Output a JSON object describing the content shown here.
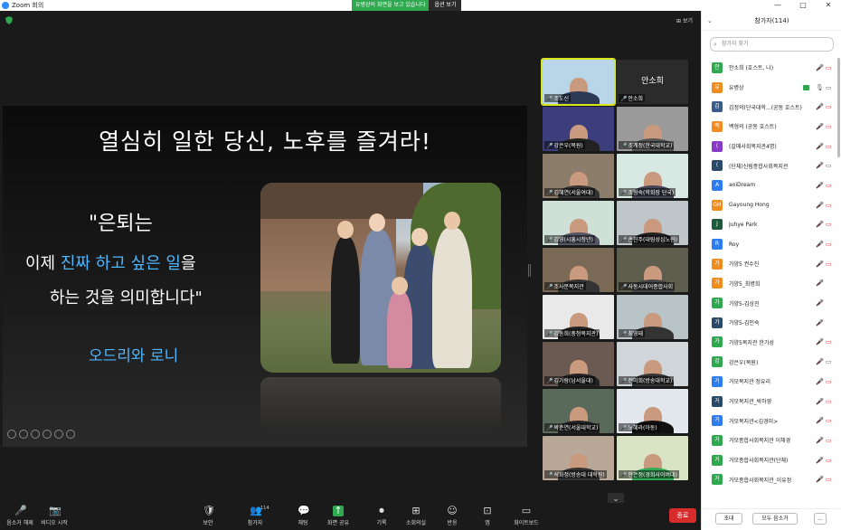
{
  "window": {
    "title": "Zoom 회의",
    "share_banner": "유병상의 화면을 보고 있습니다",
    "share_options": "옵션 보기",
    "controls": [
      "—",
      "□",
      "✕"
    ]
  },
  "meeting": {
    "view_button": "보기"
  },
  "slide": {
    "title": "열심히 일한 당신, 노후를 즐겨라!",
    "quote_line1": "\"은퇴는",
    "quote_line2_pre": "이제 ",
    "quote_line2_highlight": "진짜 하고 싶은 일",
    "quote_line2_post": "을",
    "quote_line3": "하는 것을 의미합니다\"",
    "credit": "오드리와 로니"
  },
  "gallery": {
    "tiles": [
      {
        "name": "조도신",
        "active": true,
        "body": "#2d3a55",
        "bg": "#b9d6e8"
      },
      {
        "name": "안소희",
        "big": "안소희",
        "bg": "#2b2b2b"
      },
      {
        "name": "강은우(목원)",
        "bg": "#3b3e7a",
        "body": "#222"
      },
      {
        "name": "조계정(한국대학교)",
        "bg": "#9a9a9a",
        "body": "#555"
      },
      {
        "name": "김혜연(서울여대)",
        "bg": "#8c7c6a",
        "body": "#333"
      },
      {
        "name": "조형숙(학회장 단국)",
        "bg": "#d8e8e2",
        "body": "#445"
      },
      {
        "name": "김영(시흥시청년)",
        "bg": "#cfe0d6",
        "body": "#556"
      },
      {
        "name": "손진주(대림성심노원)",
        "bg": "#bfc6c9",
        "body": "#222"
      },
      {
        "name": "조사분복지관",
        "bg": "#7a6a55",
        "body": "#333"
      },
      {
        "name": "사동시대어종합사회",
        "bg": "#5e5e4e",
        "body": "#444"
      },
      {
        "name": "김동희(충청복지관)",
        "bg": "#e9e9e9",
        "body": "#222"
      },
      {
        "name": "최영태",
        "bg": "#b8c4c8",
        "body": "#333"
      },
      {
        "name": "김가람(남서울대)",
        "bg": "#6a5a52",
        "body": "#222"
      },
      {
        "name": "전미희(방송대학교)",
        "bg": "#cfd5d8",
        "body": "#333"
      },
      {
        "name": "박춘연(서울대학교)",
        "bg": "#5a6a5a",
        "body": "#222"
      },
      {
        "name": "노혜라(아동)",
        "bg": "#e2e8ee",
        "body": "#111"
      },
      {
        "name": "석화정(방송대 대학원)",
        "bg": "#b9a898",
        "body": "#333"
      },
      {
        "name": "안은정(경희사이버대)",
        "bg": "#d8e4c4",
        "body": "#3a5"
      }
    ]
  },
  "toolbar": {
    "items": [
      {
        "label": "음소거 해제",
        "icon": "🎤"
      },
      {
        "label": "비디오 시작",
        "icon": "📷"
      },
      {
        "label": "보안",
        "icon": "🛡"
      },
      {
        "label": "참가자",
        "icon": "👥",
        "badge": "114"
      },
      {
        "label": "채팅",
        "icon": "💬"
      },
      {
        "label": "화면 공유",
        "icon": "↑"
      },
      {
        "label": "기록",
        "icon": "⏺"
      },
      {
        "label": "소회의실",
        "icon": "⊞"
      },
      {
        "label": "반응",
        "icon": "☺"
      },
      {
        "label": "앱",
        "icon": "⊡"
      },
      {
        "label": "화이트보드",
        "icon": "▭"
      }
    ],
    "end_button": "종료"
  },
  "panel": {
    "title": "참가자(114)",
    "search_placeholder": "참가자 찾기",
    "participants": [
      {
        "initial": "안",
        "name": "안소희 (호스트, 나)",
        "color": "#2fa84f",
        "mic": "off",
        "cam": "off"
      },
      {
        "initial": "유",
        "name": "유병상",
        "color": "#f08c1e",
        "mic": "on",
        "cam": "on",
        "sharing": true
      },
      {
        "initial": "김",
        "name": "김정의(단국대학...(공동 호스트)",
        "color": "#3a5a8a",
        "mic": "off",
        "cam": "off"
      },
      {
        "initial": "백",
        "name": "백형의 (공동 호스트)",
        "color": "#f08c1e",
        "mic": "off",
        "cam": "off"
      },
      {
        "initial": "(",
        "name": "(갈매사회복지관4명)",
        "color": "#8a3ac8",
        "mic": "off",
        "cam": "off"
      },
      {
        "initial": "(",
        "name": "(단체)신림종합사회복지관",
        "color": "#2a4a6a",
        "mic": "off",
        "cam": "on"
      },
      {
        "initial": "A",
        "name": "aoiDream",
        "color": "#2d7cf0",
        "mic": "off",
        "cam": "off"
      },
      {
        "initial": "GH",
        "name": "Gayoung Hong",
        "color": "#f08c1e",
        "mic": "off",
        "cam": "off"
      },
      {
        "initial": "J",
        "name": "Juhye Park",
        "color": "#1d5a3a",
        "mic": "off",
        "cam": "off"
      },
      {
        "initial": "R",
        "name": "Roy",
        "color": "#2d7cf0",
        "mic": "off",
        "cam": "off"
      },
      {
        "initial": "가",
        "name": "가양5 권수진",
        "color": "#f08c1e",
        "mic": "off",
        "cam": "off"
      },
      {
        "initial": "가",
        "name": "가양5_최병희",
        "color": "#f08c1e",
        "mic": "off",
        "cam": ""
      },
      {
        "initial": "가",
        "name": "가양5-김상진",
        "color": "#2fa84f",
        "mic": "off",
        "cam": ""
      },
      {
        "initial": "가",
        "name": "가양5-김인숙",
        "color": "#2a4a6a",
        "mic": "off",
        "cam": ""
      },
      {
        "initial": "가",
        "name": "가양5복지관 한기성",
        "color": "#2fa84f",
        "mic": "off",
        "cam": "off"
      },
      {
        "initial": "강",
        "name": "강은우(목원)",
        "color": "#2fa84f",
        "mic": "off",
        "cam": "on"
      },
      {
        "initial": "거",
        "name": "거모복지관 정유리",
        "color": "#2d7cf0",
        "mic": "off",
        "cam": "off"
      },
      {
        "initial": "거",
        "name": "거모복지관_박하영",
        "color": "#2a4a6a",
        "mic": "off",
        "cam": "off"
      },
      {
        "initial": "거",
        "name": "거모복지관<김경미>",
        "color": "#2d7cf0",
        "mic": "off",
        "cam": "off"
      },
      {
        "initial": "거",
        "name": "거모종합사회복지관 이채경",
        "color": "#2fa84f",
        "mic": "off",
        "cam": "off"
      },
      {
        "initial": "거",
        "name": "거모종합사회복지관(단체)",
        "color": "#2fa84f",
        "mic": "off",
        "cam": "off"
      },
      {
        "initial": "거",
        "name": "거모종합사회복지관_이유정",
        "color": "#2fa84f",
        "mic": "off",
        "cam": "off"
      }
    ],
    "footer": {
      "invite": "초대",
      "mute_all": "모두 음소거",
      "more": "..."
    }
  }
}
